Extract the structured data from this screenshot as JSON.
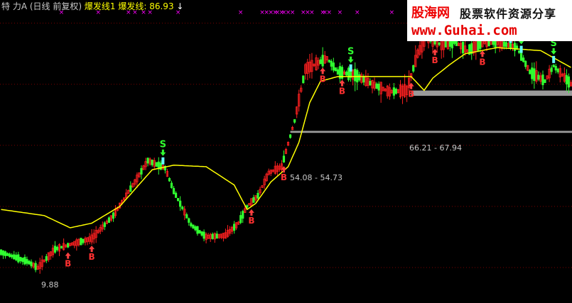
{
  "header": {
    "title": "特 力A",
    "period": "(日线 前复权)",
    "indicator1": "爆发线1",
    "indicator2": "爆发线:",
    "indicator2_value": "86.93",
    "arrow": "↓"
  },
  "watermark": {
    "brand_cn": "股海网",
    "brand_en": "www.Guhai.com",
    "slogan": "股票软件资源分享"
  },
  "chart_data": {
    "type": "candlestick",
    "title": "",
    "xlabel": "",
    "ylabel": "",
    "ylim": [
      0,
      92
    ],
    "grid": true,
    "colors": {
      "up": "#ff2020",
      "down": "#30ff30",
      "line": "#ffff00",
      "support": "#9a9a9a",
      "marker_x": "#ff00ff"
    },
    "annotations": {
      "low_label": "9.88",
      "zone1_label": "54.08 - 54.73",
      "zone2_label": "66.21 - 67.94",
      "buy_symbol": "B",
      "sell_symbol": "S"
    },
    "support_zones": [
      {
        "low": 54.08,
        "high": 54.73,
        "start": 134,
        "end": 264
      },
      {
        "low": 66.21,
        "high": 67.94,
        "start": 190,
        "end": 264
      }
    ],
    "buy_signals": [
      31,
      42,
      116,
      131,
      149,
      158,
      190,
      201,
      223
    ],
    "sell_signals": [
      75,
      162,
      199,
      236,
      241,
      256
    ],
    "x_markers": [
      28,
      45,
      59,
      62,
      66,
      69,
      82,
      111,
      121,
      123,
      125,
      127,
      128,
      130,
      131,
      133,
      135,
      140,
      142,
      144,
      149,
      150,
      152,
      157,
      165,
      181
    ],
    "price_profile": [
      [
        0,
        15.0
      ],
      [
        12,
        12.0
      ],
      [
        17,
        9.9
      ],
      [
        25,
        16.0
      ],
      [
        32,
        17.5
      ],
      [
        42,
        19.5
      ],
      [
        52,
        27.0
      ],
      [
        62,
        38.0
      ],
      [
        68,
        45.0
      ],
      [
        76,
        42.5
      ],
      [
        80,
        35.0
      ],
      [
        88,
        24.0
      ],
      [
        95,
        20.0
      ],
      [
        104,
        20.5
      ],
      [
        110,
        24.5
      ],
      [
        114,
        30.0
      ],
      [
        119,
        33.5
      ],
      [
        124,
        41.0
      ],
      [
        130,
        43.0
      ],
      [
        136,
        58.0
      ],
      [
        141,
        75.0
      ],
      [
        147,
        77.0
      ],
      [
        151,
        78.5
      ],
      [
        156,
        74.0
      ],
      [
        164,
        73.0
      ],
      [
        172,
        70.0
      ],
      [
        180,
        67.5
      ],
      [
        188,
        68.0
      ],
      [
        193,
        80.0
      ],
      [
        197,
        85.0
      ],
      [
        204,
        83.0
      ],
      [
        210,
        84.0
      ],
      [
        216,
        81.0
      ],
      [
        225,
        84.0
      ],
      [
        234,
        83.0
      ],
      [
        239,
        82.0
      ],
      [
        245,
        74.0
      ],
      [
        252,
        71.0
      ],
      [
        256,
        76.0
      ],
      [
        264,
        70.0
      ]
    ],
    "yellow_line_profile": [
      [
        0,
        29.0
      ],
      [
        20,
        27.0
      ],
      [
        32,
        23.0
      ],
      [
        42,
        24.5
      ],
      [
        55,
        30.0
      ],
      [
        70,
        42.0
      ],
      [
        80,
        43.5
      ],
      [
        95,
        43.0
      ],
      [
        108,
        37.0
      ],
      [
        114,
        29.0
      ],
      [
        118,
        31.0
      ],
      [
        125,
        38.0
      ],
      [
        133,
        43.0
      ],
      [
        138,
        51.0
      ],
      [
        143,
        64.0
      ],
      [
        148,
        71.0
      ],
      [
        156,
        72.5
      ],
      [
        175,
        72.5
      ],
      [
        190,
        72.5
      ],
      [
        196,
        68.0
      ],
      [
        200,
        72.0
      ],
      [
        208,
        76.5
      ],
      [
        215,
        80.0
      ],
      [
        230,
        82.0
      ],
      [
        250,
        81.0
      ],
      [
        264,
        75.5
      ]
    ],
    "bars": 265
  }
}
